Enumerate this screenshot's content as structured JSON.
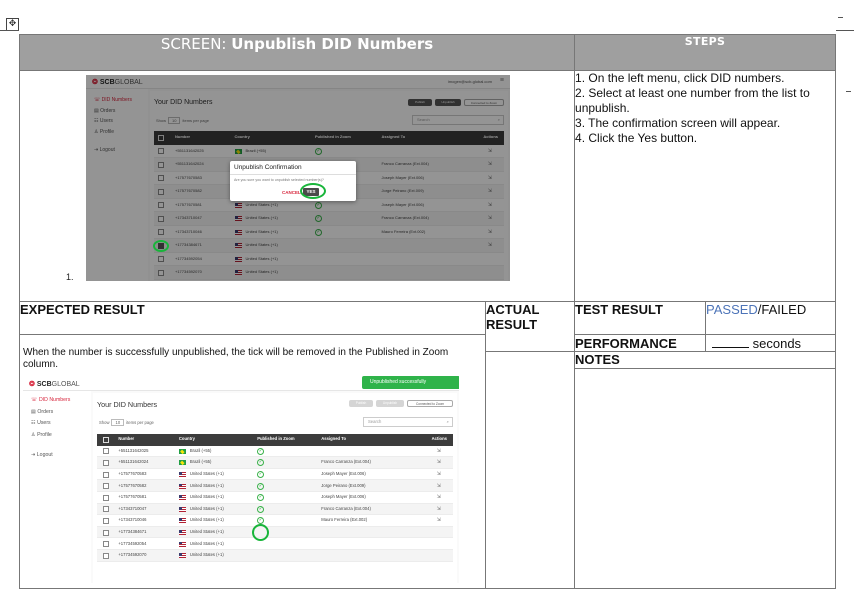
{
  "header": {
    "screen_prefix": "SCREEN: ",
    "screen_title": "Unpublish DID Numbers",
    "steps_title": "STEPS"
  },
  "steps": [
    "1. On the left menu, click DID numbers.",
    "2. Select at least one number from the list to unpublish.",
    "3. The confirmation screen will appear.",
    "4. Click the Yes button."
  ],
  "screenshot_label": "1.",
  "labels": {
    "expected_result": "EXPECTED RESULT",
    "actual_result": "ACTUAL RESULT",
    "test_result": "TEST RESULT",
    "passed": "PASSED",
    "slash_failed": "/FAILED",
    "performance": "PERFORMANCE",
    "seconds": " seconds",
    "notes": "NOTES"
  },
  "expected_text": "When the number is successfully unpublished, the tick will be removed in the Published in Zoom column.",
  "app": {
    "logo_scb": "SCB",
    "logo_global": "GLOBAL",
    "user_email": "imogen@scb-global.com",
    "sidebar": [
      "DID Numbers",
      "Orders",
      "Users",
      "Profile",
      "Logout"
    ],
    "page_title": "Your DID Numbers",
    "buttons": [
      "Publish",
      "Unpublish",
      "Connected to Zoom"
    ],
    "show_label": "Show",
    "show_value": "10",
    "show_suffix": "items per page",
    "search_placeholder": "Search",
    "columns": [
      "Number",
      "Country",
      "Published in Zoom",
      "Assigned To",
      "Actions"
    ],
    "rows": [
      {
        "number": "+551131642025",
        "country": "Brazil (+55)",
        "flag": "br",
        "published": true,
        "assigned": ""
      },
      {
        "number": "+551131642024",
        "country": "Brazil (+55)",
        "flag": "br",
        "published": true,
        "assigned": "Franco Carranza (Ext.004)"
      },
      {
        "number": "+17577670583",
        "country": "United States (+1)",
        "flag": "us",
        "published": true,
        "assigned": "Joseph Mayer (Ext.006)"
      },
      {
        "number": "+17577670582",
        "country": "United States (+1)",
        "flag": "us",
        "published": true,
        "assigned": "Jorge Peirano (Ext.009)"
      },
      {
        "number": "+17577670581",
        "country": "United States (+1)",
        "flag": "us",
        "published": true,
        "assigned": "Joseph Mayer (Ext.006)"
      },
      {
        "number": "+17343710047",
        "country": "United States (+1)",
        "flag": "us",
        "published": true,
        "assigned": "Franco Carranza (Ext.004)"
      },
      {
        "number": "+17343710046",
        "country": "United States (+1)",
        "flag": "us",
        "published": true,
        "assigned": "Mauro Ferreira (Ext.002)"
      },
      {
        "number": "+17734384671",
        "country": "United States (+1)",
        "flag": "us",
        "published": false,
        "assigned": ""
      },
      {
        "number": "+17734592054",
        "country": "United States (+1)",
        "flag": "us",
        "published": false,
        "assigned": ""
      },
      {
        "number": "+17734592070",
        "country": "United States (+1)",
        "flag": "us",
        "published": false,
        "assigned": ""
      }
    ],
    "modal": {
      "title": "Unpublish Confirmation",
      "text": "Are you sure you want to unpublish selected number(s)?",
      "cancel": "CANCEL",
      "yes": "YES"
    },
    "toast": "Unpublished successfully",
    "tick_glyph": "✓",
    "action_glyph": "⇲"
  },
  "colors": {
    "header_bg": "#9f9f9f",
    "brand_red": "#d7263d",
    "highlight_green": "#18b53a",
    "passed_blue": "#4d74b8",
    "table_head": "#3c3c3c"
  }
}
